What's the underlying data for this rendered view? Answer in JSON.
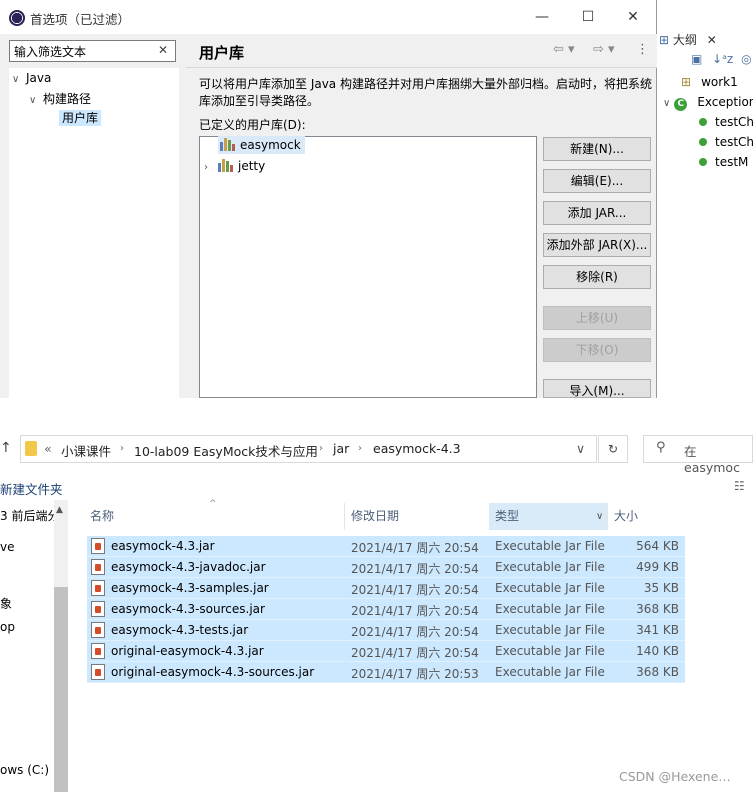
{
  "prefs": {
    "title": "首选项（已过滤）",
    "filter_value": "输入筛选文本",
    "tree": [
      "Java",
      "构建路径",
      "用户库"
    ],
    "page_title": "用户库",
    "description": "可以将用户库添加至 Java 构建路径并对用户库捆绑大量外部归档。启动时，将把系统库添加至引导类路径。",
    "defined_label": "已定义的用户库(D):",
    "libraries": [
      "easymock",
      "jetty"
    ],
    "buttons": {
      "new": "新建(N)...",
      "edit": "编辑(E)...",
      "add_jar": "添加 JAR...",
      "add_external_jar": "添加外部 JAR(X)...",
      "remove": "移除(R)",
      "up": "上移(U)",
      "down": "下移(O)",
      "import": "导入(M)..."
    }
  },
  "outline": {
    "title": "大纲",
    "items": [
      "work1",
      "Exception",
      "testCh",
      "testCh",
      "testM"
    ]
  },
  "explorer": {
    "breadcrumb": [
      "小课课件",
      "10-lab09 EasyMock技术与应用",
      "jar",
      "easymock-4.3"
    ],
    "search_placeholder": "在 easymoc",
    "new_folder": "新建文件夹",
    "nav_items": [
      "3 前后端分",
      "ve",
      "象",
      "op",
      "ows (C:)"
    ],
    "columns": {
      "name": "名称",
      "date": "修改日期",
      "type": "类型",
      "size": "大小"
    },
    "files": [
      {
        "name": "easymock-4.3.jar",
        "date": "2021/4/17 周六 20:54",
        "type": "Executable Jar File",
        "size": "564 KB"
      },
      {
        "name": "easymock-4.3-javadoc.jar",
        "date": "2021/4/17 周六 20:54",
        "type": "Executable Jar File",
        "size": "499 KB"
      },
      {
        "name": "easymock-4.3-samples.jar",
        "date": "2021/4/17 周六 20:54",
        "type": "Executable Jar File",
        "size": "35 KB"
      },
      {
        "name": "easymock-4.3-sources.jar",
        "date": "2021/4/17 周六 20:54",
        "type": "Executable Jar File",
        "size": "368 KB"
      },
      {
        "name": "easymock-4.3-tests.jar",
        "date": "2021/4/17 周六 20:54",
        "type": "Executable Jar File",
        "size": "341 KB"
      },
      {
        "name": "original-easymock-4.3.jar",
        "date": "2021/4/17 周六 20:54",
        "type": "Executable Jar File",
        "size": "140 KB"
      },
      {
        "name": "original-easymock-4.3-sources.jar",
        "date": "2021/4/17 周六 20:53",
        "type": "Executable Jar File",
        "size": "368 KB"
      }
    ]
  },
  "watermark": "CSDN @Hexene…"
}
